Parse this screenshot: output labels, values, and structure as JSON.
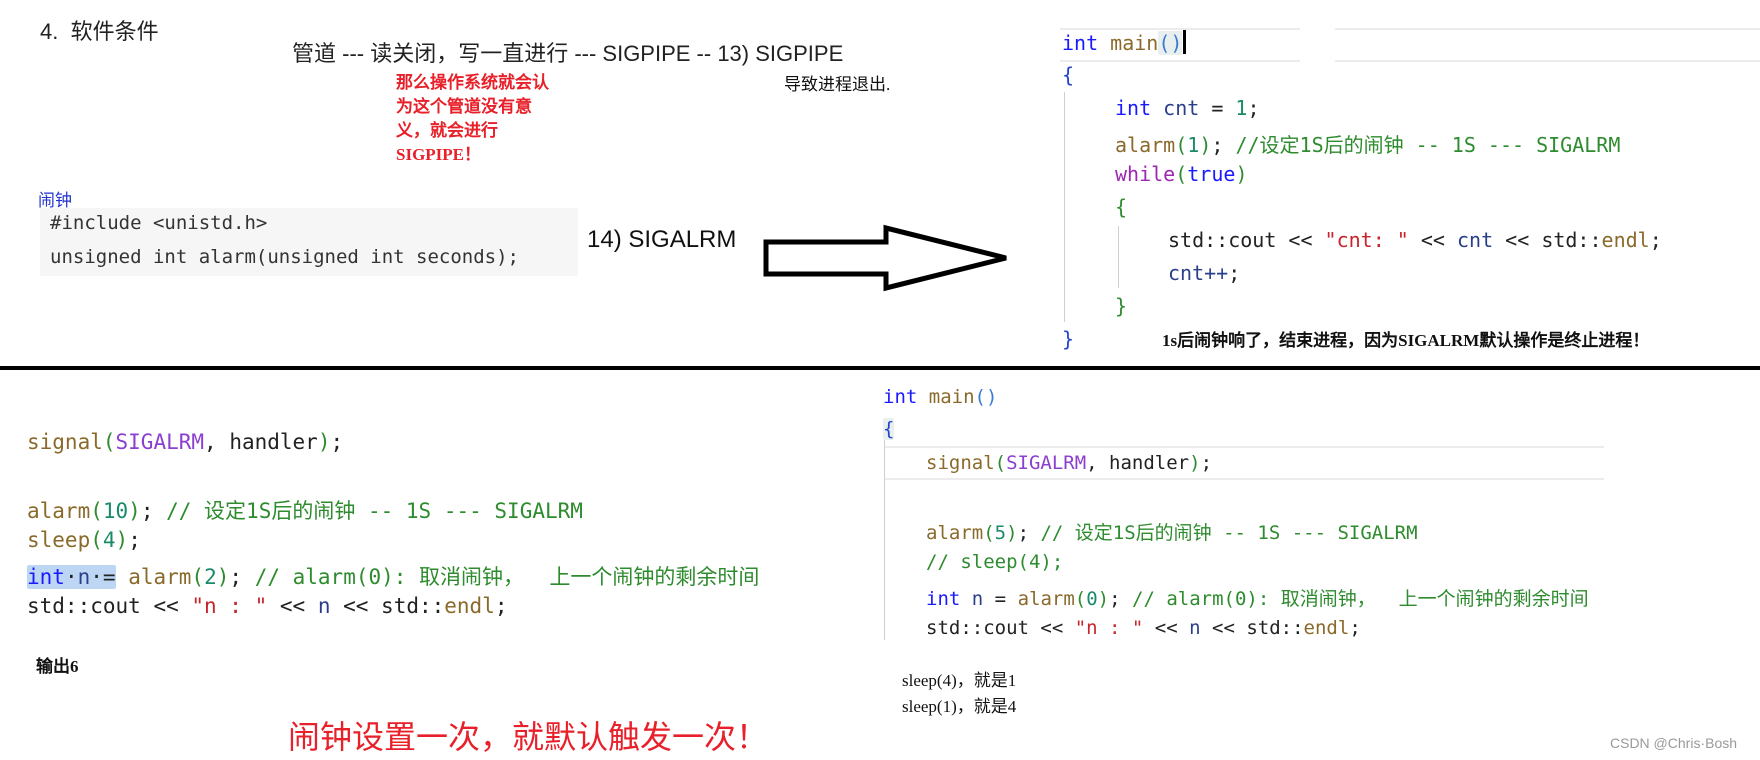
{
  "section_title": "4.  软件条件",
  "pipe_line": "管道 --- 读关闭，写一直进行 --- SIGPIPE -- 13) SIGPIPE",
  "pipe_note_lines": [
    "那么操作系统就会认",
    "为这个管道没有意",
    "义，就会进行",
    "SIGPIPE！"
  ],
  "pipe_exit_note": "导致进程退出.",
  "alarm_label": "闹钟",
  "alarm_prototype": {
    "include_line": "#include <unistd.h>",
    "signature_line": "unsigned int alarm(unsigned int seconds);"
  },
  "sigalrm_number": "14) SIGALRM",
  "arrow_icon": "right-arrow",
  "top_right_code": {
    "main_kw": "int",
    "main_fn": "main",
    "main_parens": "()",
    "open_brace": "{",
    "decl_kw": "int",
    "decl_var": "cnt",
    "decl_op": " = ",
    "decl_val": "1",
    "decl_end": ";",
    "alarm_fn": "alarm",
    "alarm_arg": "1",
    "alarm_end": "; ",
    "alarm_comment": "//设定1S后的闹钟 -- 1S --- SIGALRM",
    "while_kw": "while",
    "while_cond": "true",
    "inner_open": "{",
    "cout_ns": "std::cout",
    "cout_op": " << ",
    "cout_str": "\"cnt: \"",
    "cout_var": "cnt",
    "cout_endl_ns": "std::",
    "cout_endl": "endl",
    "cout_end": ";",
    "incr": "cnt++",
    "incr_end": ";",
    "inner_close": "}",
    "close_brace": "}"
  },
  "top_right_summary": "1s后闹钟响了，结束进程，因为SIGALRM默认操作是终止进程！",
  "bottom_left_code": {
    "signal_fn": "signal",
    "signal_macro": "SIGALRM",
    "signal_handler": ", handler",
    "signal_end": ";",
    "alarm_fn": "alarm",
    "alarm_arg": "10",
    "alarm_comment": "// 设定1S后的闹钟 -- 1S --- SIGALRM",
    "sleep_fn": "sleep",
    "sleep_arg": "4",
    "n_kw": "int",
    "n_var": "n",
    "n_op": " =",
    "n_alarm_fn": "alarm",
    "n_alarm_arg": "2",
    "n_comment": "// alarm(0): 取消闹钟，  上一个闹钟的剩余时间",
    "cout_ns": "std::cout",
    "cout_str": "\"n : \"",
    "cout_var": "n",
    "cout_endl_ns": "std::",
    "cout_endl": "endl"
  },
  "bottom_left_output": "输出6",
  "bottom_banner": "闹钟设置一次，就默认触发一次！",
  "bottom_right_code": {
    "main_kw": "int",
    "main_fn": "main",
    "main_parens": "()",
    "open_brace": "{",
    "signal_fn": "signal",
    "signal_macro": "SIGALRM",
    "signal_handler": ", handler",
    "alarm_fn": "alarm",
    "alarm_arg": "5",
    "alarm_comment": "// 设定1S后的闹钟 -- 1S --- SIGALRM",
    "sleep_comment": "// sleep(4);",
    "n_kw": "int",
    "n_var": "n",
    "n_alarm_fn": "alarm",
    "n_alarm_arg": "0",
    "n_comment": "// alarm(0): 取消闹钟，  上一个闹钟的剩余时间",
    "cout_ns": "std::cout",
    "cout_str": "\"n : \"",
    "cout_var": "n",
    "cout_endl_ns": "std::",
    "cout_endl": "endl"
  },
  "sleep_notes": [
    "sleep(4)，就是1",
    "sleep(1)，就是4"
  ],
  "watermark": "CSDN @Chris·Bosh"
}
